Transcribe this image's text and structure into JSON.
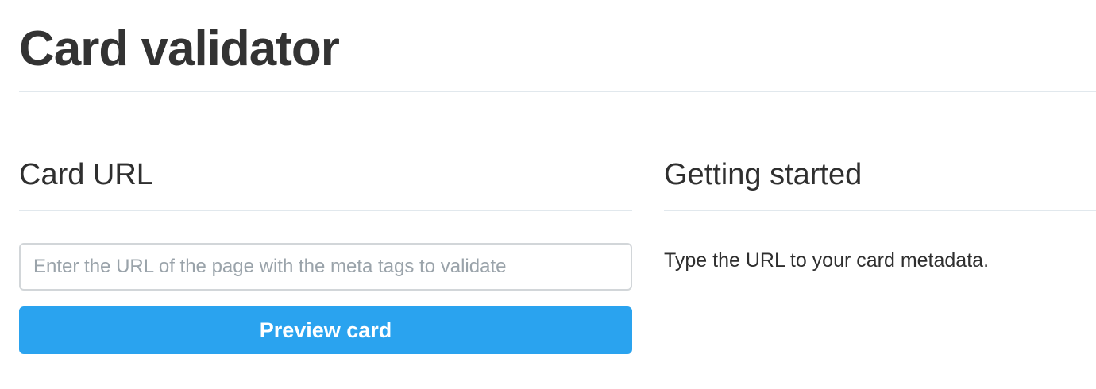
{
  "page": {
    "title": "Card validator"
  },
  "card_url": {
    "heading": "Card URL",
    "input_value": "",
    "input_placeholder": "Enter the URL of the page with the meta tags to validate",
    "button_label": "Preview card"
  },
  "getting_started": {
    "heading": "Getting started",
    "text": "Type the URL to your card metadata."
  },
  "colors": {
    "button_background": "#2aa3ef",
    "button_text": "#ffffff",
    "divider": "#e1e8ed",
    "input_border": "#d2d6d9",
    "placeholder_text": "#9aa3aa"
  }
}
